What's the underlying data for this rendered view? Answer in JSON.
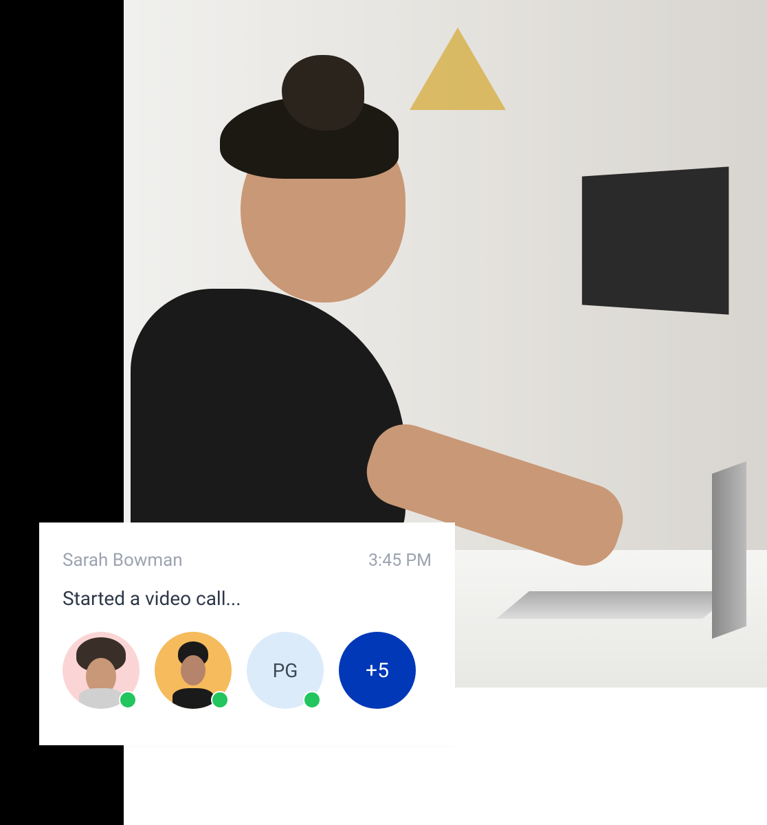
{
  "notification": {
    "sender": "Sarah Bowman",
    "timestamp": "3:45 PM",
    "message": "Started a video call...",
    "participants": [
      {
        "type": "avatar",
        "online": true
      },
      {
        "type": "avatar",
        "online": true
      },
      {
        "type": "initials",
        "initials": "PG",
        "online": true
      },
      {
        "type": "overflow",
        "label": "+5"
      }
    ]
  }
}
